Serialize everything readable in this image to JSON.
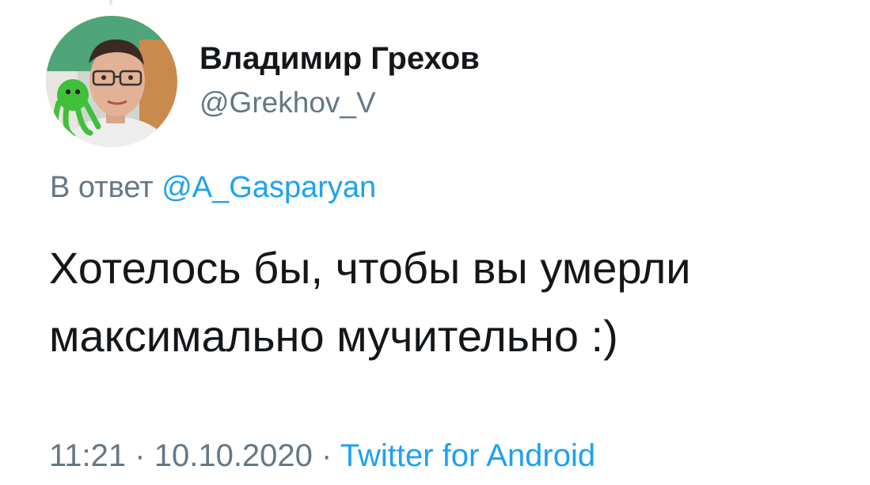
{
  "author": {
    "display_name": "Владимир Грехов",
    "handle": "@Grekhov_V"
  },
  "reply": {
    "prefix": "В ответ",
    "to": "@A_Gasparyan"
  },
  "tweet": {
    "text": "Хотелось бы, чтобы вы умерли\nмаксимально мучительно :)"
  },
  "meta": {
    "time": "11:21",
    "separator": "·",
    "date": "10.10.2020",
    "source": "Twitter for Android"
  },
  "colors": {
    "text": "#14171a",
    "secondary": "#657786",
    "link": "#1da1f2"
  }
}
